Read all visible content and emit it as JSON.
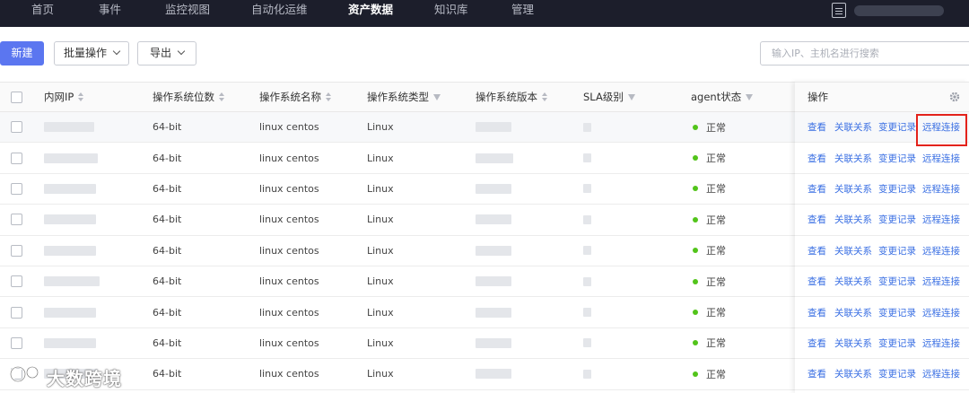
{
  "nav": {
    "items": [
      {
        "label": "首页",
        "active": false
      },
      {
        "label": "事件",
        "active": false
      },
      {
        "label": "监控视图",
        "active": false
      },
      {
        "label": "自动化运维",
        "active": false
      },
      {
        "label": "资产数据",
        "active": true
      },
      {
        "label": "知识库",
        "active": false
      },
      {
        "label": "管理",
        "active": false
      }
    ]
  },
  "toolbar": {
    "new_label": "新建",
    "batch_label": "批量操作",
    "export_label": "导出",
    "search_placeholder": "输入IP、主机名进行搜索"
  },
  "table": {
    "headers": {
      "ip": "内网IP",
      "bits": "操作系统位数",
      "os_name": "操作系统名称",
      "os_type": "操作系统类型",
      "os_version": "操作系统版本",
      "sla": "SLA级别",
      "agent": "agent状态",
      "actions": "操作"
    },
    "rows": [
      {
        "bits": "64-bit",
        "os_name": "linux centos",
        "os_type": "Linux",
        "agent": "正常"
      },
      {
        "bits": "64-bit",
        "os_name": "linux centos",
        "os_type": "Linux",
        "agent": "正常"
      },
      {
        "bits": "64-bit",
        "os_name": "linux centos",
        "os_type": "Linux",
        "agent": "正常"
      },
      {
        "bits": "64-bit",
        "os_name": "linux centos",
        "os_type": "Linux",
        "agent": "正常"
      },
      {
        "bits": "64-bit",
        "os_name": "linux centos",
        "os_type": "Linux",
        "agent": "正常"
      },
      {
        "bits": "64-bit",
        "os_name": "linux centos",
        "os_type": "Linux",
        "agent": "正常"
      },
      {
        "bits": "64-bit",
        "os_name": "linux centos",
        "os_type": "Linux",
        "agent": "正常"
      },
      {
        "bits": "64-bit",
        "os_name": "linux centos",
        "os_type": "Linux",
        "agent": "正常"
      },
      {
        "bits": "64-bit",
        "os_name": "linux centos",
        "os_type": "Linux",
        "agent": "正常"
      }
    ],
    "actions": [
      "查看",
      "关联关系",
      "变更记录",
      "远程连接"
    ]
  },
  "watermark": {
    "text": "大数跨境"
  },
  "colors": {
    "nav_bg": "#1c1e2b",
    "primary": "#5b76f0",
    "link": "#3a6fe3",
    "status_ok": "#52c41a",
    "highlight": "#e3221b"
  }
}
